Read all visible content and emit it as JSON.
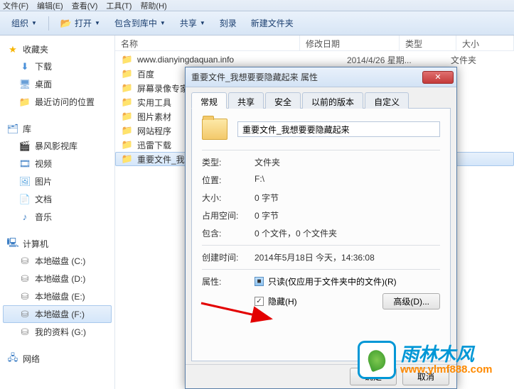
{
  "menubar": {
    "items": [
      "文件(F)",
      "编辑(E)",
      "查看(V)",
      "工具(T)",
      "帮助(H)"
    ]
  },
  "toolbar": {
    "organize": "组织",
    "open": "打开",
    "include": "包含到库中",
    "share": "共享",
    "burn": "刻录",
    "newfolder": "新建文件夹"
  },
  "sidebar": {
    "favorites": {
      "label": "收藏夹",
      "items": [
        "下载",
        "桌面",
        "最近访问的位置"
      ]
    },
    "library": {
      "label": "库",
      "items": [
        "暴风影视库",
        "视频",
        "图片",
        "文档",
        "音乐"
      ]
    },
    "computer": {
      "label": "计算机",
      "items": [
        "本地磁盘 (C:)",
        "本地磁盘 (D:)",
        "本地磁盘 (E:)",
        "本地磁盘 (F:)",
        "我的资料 (G:)"
      ]
    },
    "network": {
      "label": "网络"
    }
  },
  "columns": {
    "name": "名称",
    "date": "修改日期",
    "type": "类型",
    "size": "大小"
  },
  "files": [
    {
      "name": "www.dianyingdaquan.info",
      "date": "2014/4/26 星期...",
      "type": "文件夹"
    },
    {
      "name": "百度"
    },
    {
      "name": "屏幕录像专家"
    },
    {
      "name": "实用工具"
    },
    {
      "name": "图片素材"
    },
    {
      "name": "网站程序"
    },
    {
      "name": "迅雷下载"
    },
    {
      "name": "重要文件_我想"
    }
  ],
  "dialog": {
    "title": "重要文件_我想要要隐藏起来 属性",
    "tabs": [
      "常规",
      "共享",
      "安全",
      "以前的版本",
      "自定义"
    ],
    "name_value": "重要文件_我想要要隐藏起来",
    "rows": {
      "type_l": "类型:",
      "type_v": "文件夹",
      "loc_l": "位置:",
      "loc_v": "F:\\",
      "size_l": "大小:",
      "size_v": "0 字节",
      "disk_l": "占用空间:",
      "disk_v": "0 字节",
      "cont_l": "包含:",
      "cont_v": "0 个文件，0 个文件夹",
      "ctime_l": "创建时间:",
      "ctime_v": "2014年5月18日 今天，14:36:08",
      "attr_l": "属性:",
      "readonly": "只读(仅应用于文件夹中的文件)(R)",
      "hidden": "隐藏(H)",
      "advanced": "高级(D)..."
    },
    "buttons": {
      "ok": "确定",
      "cancel": "取消"
    }
  },
  "watermark": {
    "brand": "雨林木风",
    "url": "www.ylmf888.com"
  }
}
